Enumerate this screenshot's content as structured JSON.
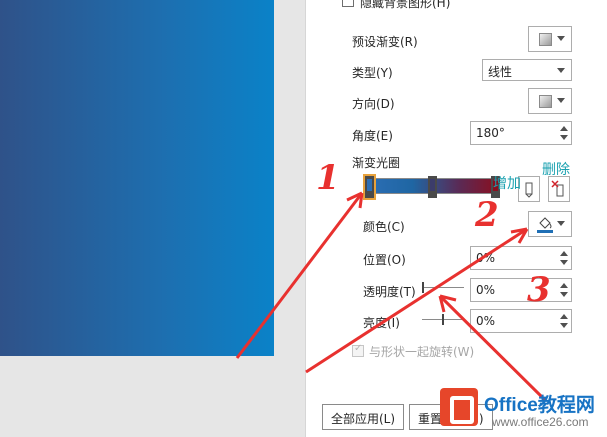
{
  "pane": {
    "hide_background": "隐藏背景图形(H)",
    "preset_gradient": "预设渐变(R)",
    "type_label": "类型(Y)",
    "type_value": "线性",
    "direction_label": "方向(D)",
    "angle_label": "角度(E)",
    "angle_value": "180°",
    "gradient_stops_label": "渐变光圈",
    "add_label": "增加",
    "delete_label": "删除",
    "color_label": "颜色(C)",
    "position_label": "位置(O)",
    "position_value": "0%",
    "transparency_label": "透明度(T)",
    "transparency_value": "0%",
    "brightness_label": "亮度(I)",
    "brightness_value": "0%",
    "rotate_with_shape": "与形状一起旋转(W)",
    "apply_all_button": "全部应用(L)",
    "reset_button": "重置背景(B)"
  },
  "annotations": {
    "n1": "1",
    "n2": "2",
    "n3": "3"
  },
  "watermark": {
    "title": "Office教程网",
    "url": "www.office26.com"
  },
  "gradient_stops": [
    {
      "position": 0,
      "color": "#2c6eb5",
      "selected": true
    },
    {
      "position": 0.5,
      "color": "#3c3c6a",
      "selected": false
    },
    {
      "position": 1,
      "color": "#8b0e1e",
      "selected": false
    }
  ],
  "colors": {
    "slide_gradient_start": "#2f5289",
    "slide_gradient_end": "#0a82c8",
    "annotation_red": "#e8312f",
    "annotation_teal": "#1aa1b0"
  }
}
